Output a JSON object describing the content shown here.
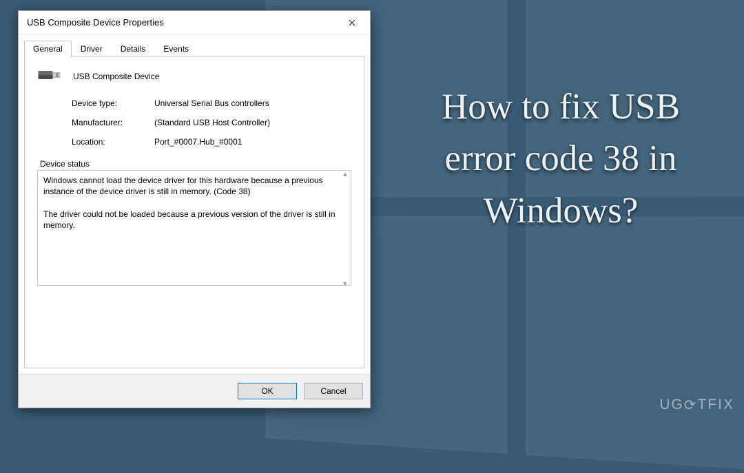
{
  "dialog": {
    "title": "USB Composite Device Properties",
    "tabs": [
      "General",
      "Driver",
      "Details",
      "Events"
    ],
    "active_tab": 0,
    "device_name": "USB Composite Device",
    "rows": {
      "device_type_label": "Device type:",
      "device_type_value": "Universal Serial Bus controllers",
      "manufacturer_label": "Manufacturer:",
      "manufacturer_value": "(Standard USB Host Controller)",
      "location_label": "Location:",
      "location_value": "Port_#0007.Hub_#0001"
    },
    "status_label": "Device status",
    "status_text": "Windows cannot load the device driver for this hardware because a previous instance of the device driver is still in memory. (Code 38)\n\nThe driver could not be loaded because a previous version of the driver is still in memory.",
    "buttons": {
      "ok": "OK",
      "cancel": "Cancel"
    }
  },
  "headline": "How to fix USB error code 38 in Windows?",
  "watermark": "UG⟳TFIX"
}
